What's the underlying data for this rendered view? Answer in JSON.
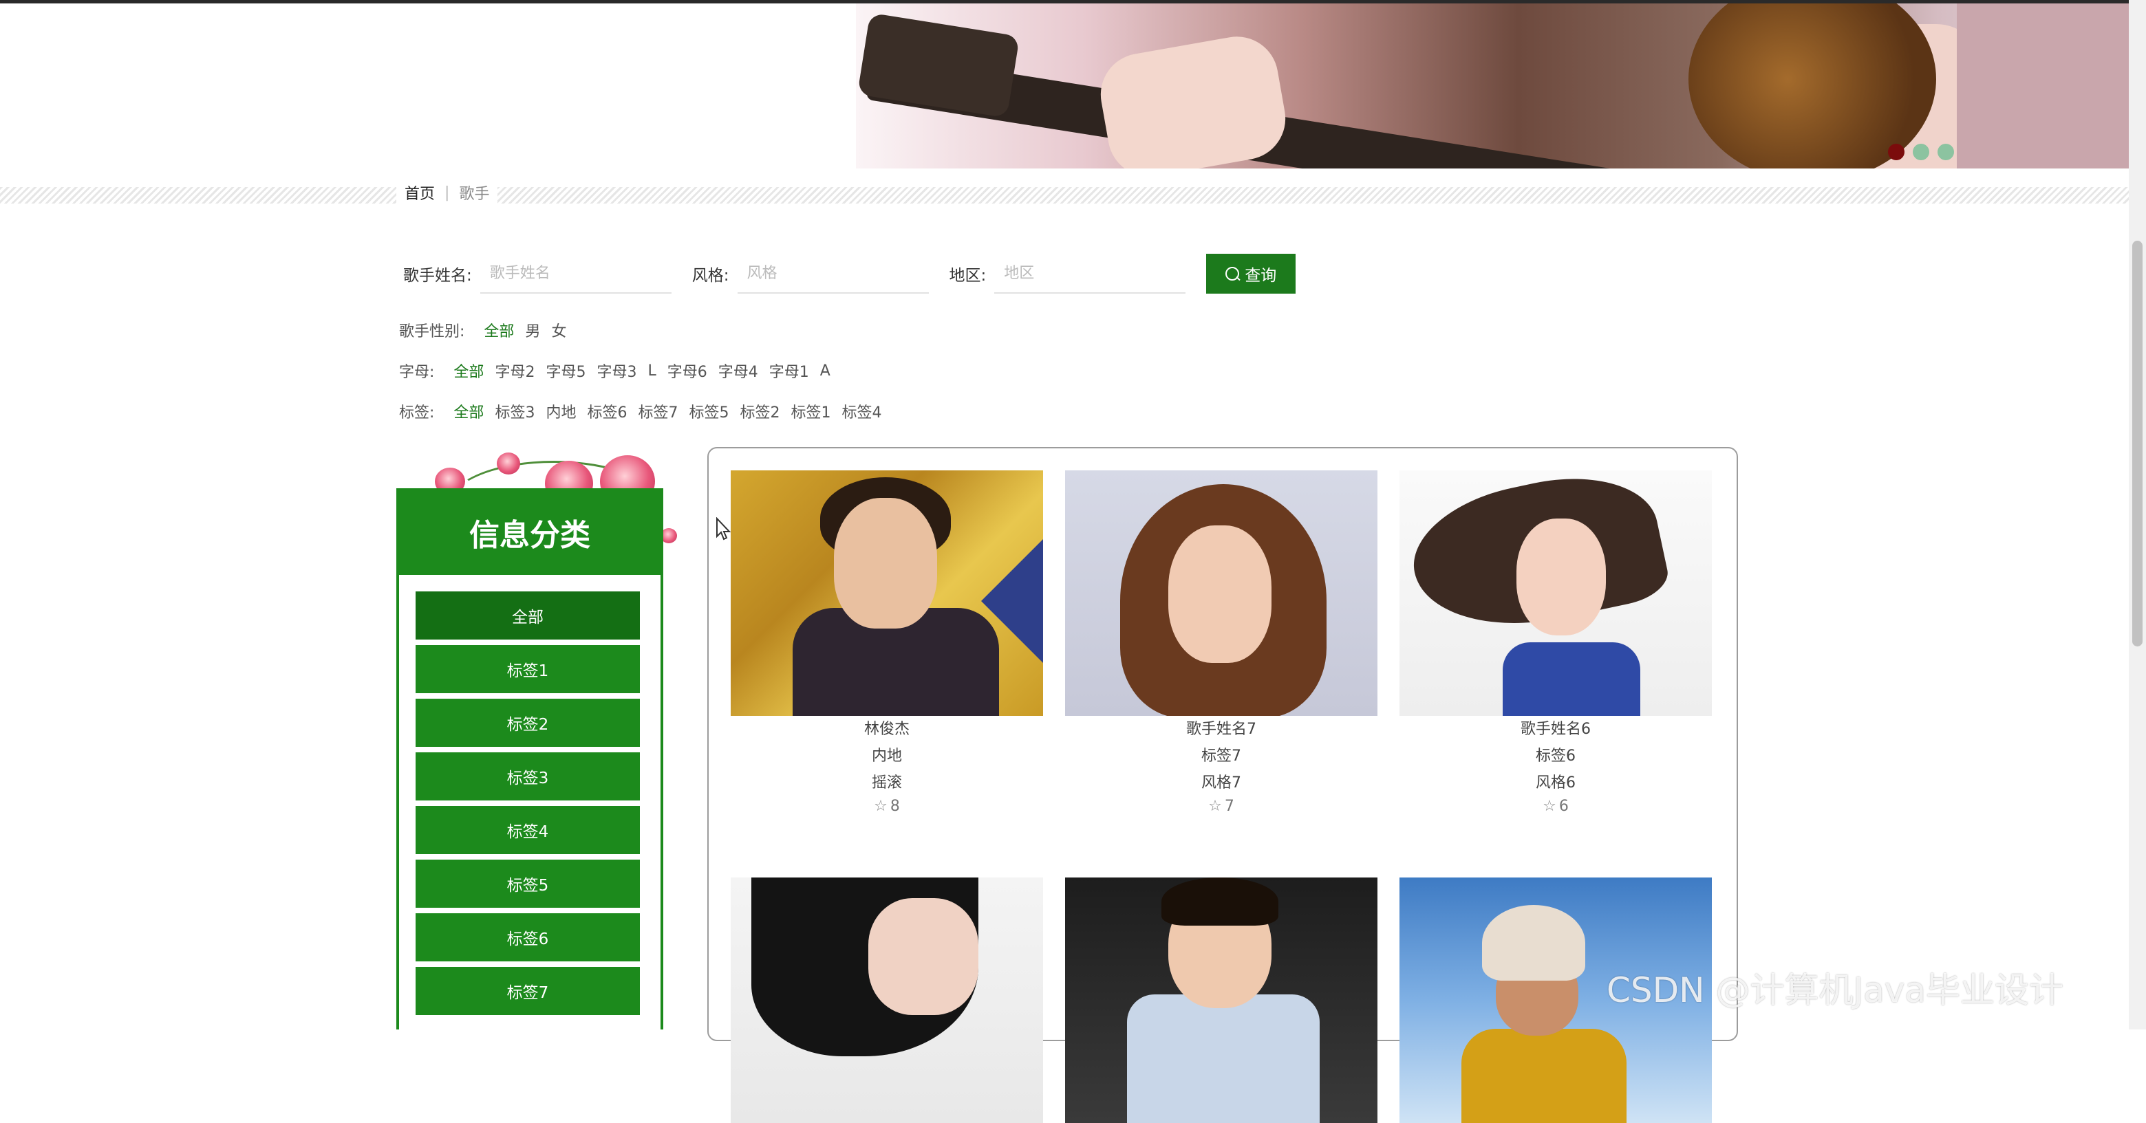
{
  "banner": {
    "slides": [
      {
        "active": true
      },
      {
        "active": false
      },
      {
        "active": false
      }
    ]
  },
  "breadcrumb": {
    "home": "首页",
    "current": "歌手"
  },
  "search": {
    "name_label": "歌手姓名:",
    "name_placeholder": "歌手姓名",
    "style_label": "风格:",
    "style_placeholder": "风格",
    "region_label": "地区:",
    "region_placeholder": "地区",
    "button_label": "查询"
  },
  "filters": {
    "gender": {
      "label": "歌手性别:",
      "options": [
        "全部",
        "男",
        "女"
      ]
    },
    "letter": {
      "label": "字母:",
      "options": [
        "全部",
        "字母2",
        "字母5",
        "字母3",
        "L",
        "字母6",
        "字母4",
        "字母1",
        "A"
      ]
    },
    "tag": {
      "label": "标签:",
      "options": [
        "全部",
        "标签3",
        "内地",
        "标签6",
        "标签7",
        "标签5",
        "标签2",
        "标签1",
        "标签4"
      ]
    }
  },
  "sidebar": {
    "title": "信息分类",
    "items": [
      "全部",
      "标签1",
      "标签2",
      "标签3",
      "标签4",
      "标签5",
      "标签6",
      "标签7"
    ]
  },
  "singers": [
    {
      "name": "林俊杰",
      "tag": "内地",
      "style": "摇滚",
      "favorites": "8"
    },
    {
      "name": "歌手姓名7",
      "tag": "标签7",
      "style": "风格7",
      "favorites": "7"
    },
    {
      "name": "歌手姓名6",
      "tag": "标签6",
      "style": "风格6",
      "favorites": "6"
    }
  ],
  "watermark": "CSDN @计算机Java毕业设计",
  "colors": {
    "accent": "#1c8a1c",
    "active_dot": "#7b0c0c",
    "inactive_dot": "#8cc3a0"
  }
}
